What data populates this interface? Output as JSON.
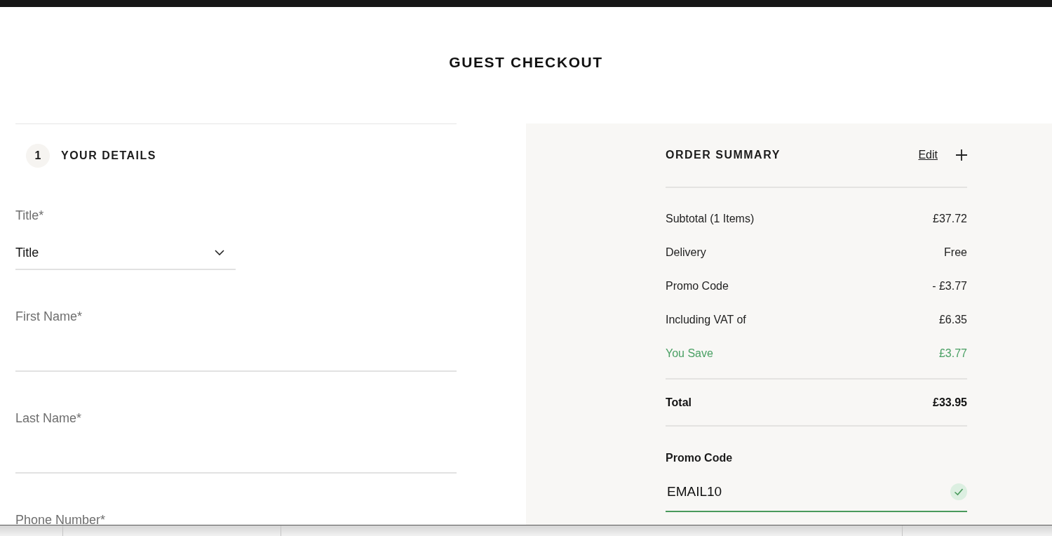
{
  "page": {
    "title": "GUEST CHECKOUT"
  },
  "details": {
    "step": "1",
    "heading": "YOUR DETAILS",
    "fields": [
      {
        "kind": "select",
        "label": "Title*",
        "value": "Title"
      },
      {
        "kind": "text",
        "label": "First Name*"
      },
      {
        "kind": "text",
        "label": "Last Name*"
      },
      {
        "kind": "label",
        "label": "Phone Number*"
      }
    ]
  },
  "summary": {
    "heading": "ORDER SUMMARY",
    "edit": "Edit",
    "expanded": false,
    "lines": [
      {
        "kind": "line",
        "label": "Subtotal (1 Items)",
        "amount": "£37.72"
      },
      {
        "kind": "line",
        "label": "Delivery",
        "amount": "Free"
      },
      {
        "kind": "line",
        "label": "Promo Code",
        "amount": "- £3.77"
      },
      {
        "kind": "line",
        "label": "Including VAT of",
        "amount": "£6.35"
      },
      {
        "kind": "saving",
        "label": "You Save",
        "amount": "£3.77"
      },
      {
        "kind": "total",
        "label": "Total",
        "amount": "£33.95"
      }
    ]
  },
  "promo": {
    "label": "Promo Code",
    "value": "EMAIL10",
    "valid": true
  }
}
